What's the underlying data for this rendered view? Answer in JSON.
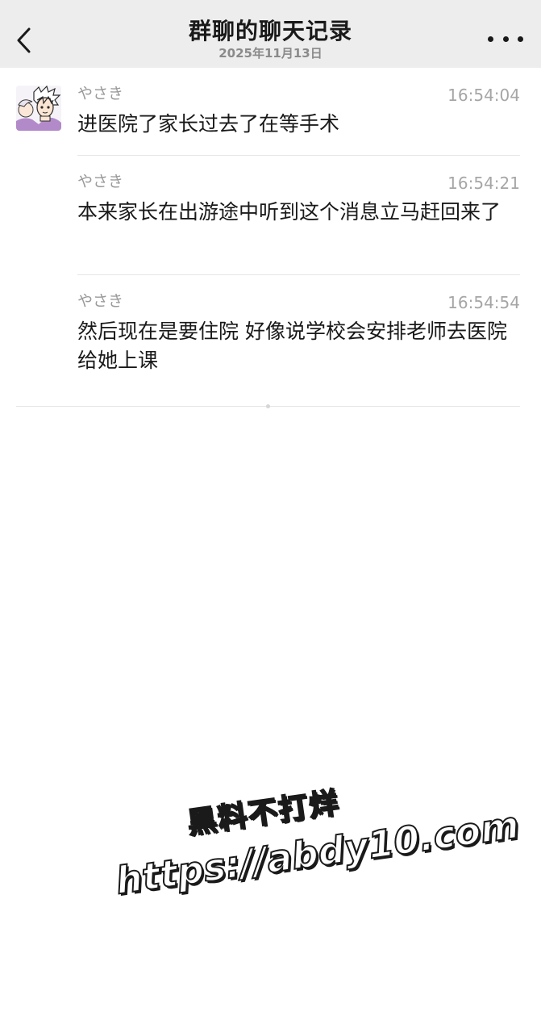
{
  "header": {
    "title": "群聊的聊天记录",
    "subtitle": "2025年11月13日",
    "back_icon": "chevron-left-icon",
    "more_icon": "more-dots-icon"
  },
  "messages": [
    {
      "nickname": "やさき",
      "time": "16:54:04",
      "text": "进医院了家长过去了在等手术"
    },
    {
      "nickname": "やさき",
      "time": "16:54:21",
      "text": "本来家长在出游途中听到这个消息立马赶回来了"
    },
    {
      "nickname": "やさき",
      "time": "16:54:54",
      "text": "然后现在是要住院 好像说学校会安排老师去医院给她上课"
    }
  ],
  "watermark": {
    "line1": "黑料不打烊",
    "line2": "https://abdy10.com"
  },
  "colors": {
    "header_bg": "#ededed",
    "page_bg": "#ffffff",
    "text_primary": "#191919",
    "text_secondary": "#9a9a9a"
  }
}
